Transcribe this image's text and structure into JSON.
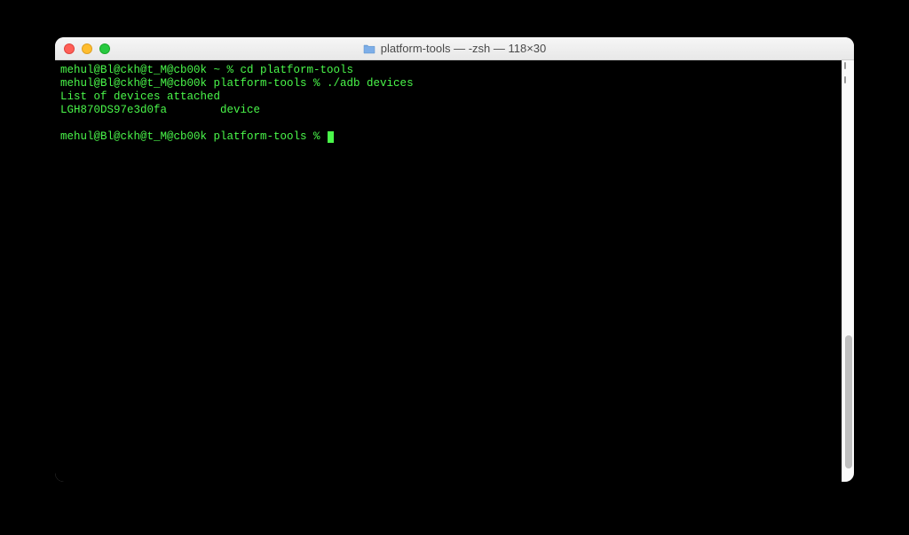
{
  "window": {
    "title": "platform-tools — -zsh — 118×30"
  },
  "terminal": {
    "lines": [
      "mehul@Bl@ckh@t_M@cb00k ~ % cd platform-tools",
      "mehul@Bl@ckh@t_M@cb00k platform-tools % ./adb devices",
      "List of devices attached",
      "LGH870DS97e3d0fa        device"
    ],
    "prompt": "mehul@Bl@ckh@t_M@cb00k platform-tools % "
  },
  "colors": {
    "terminal_bg": "#000000",
    "terminal_fg": "#4af74a"
  }
}
